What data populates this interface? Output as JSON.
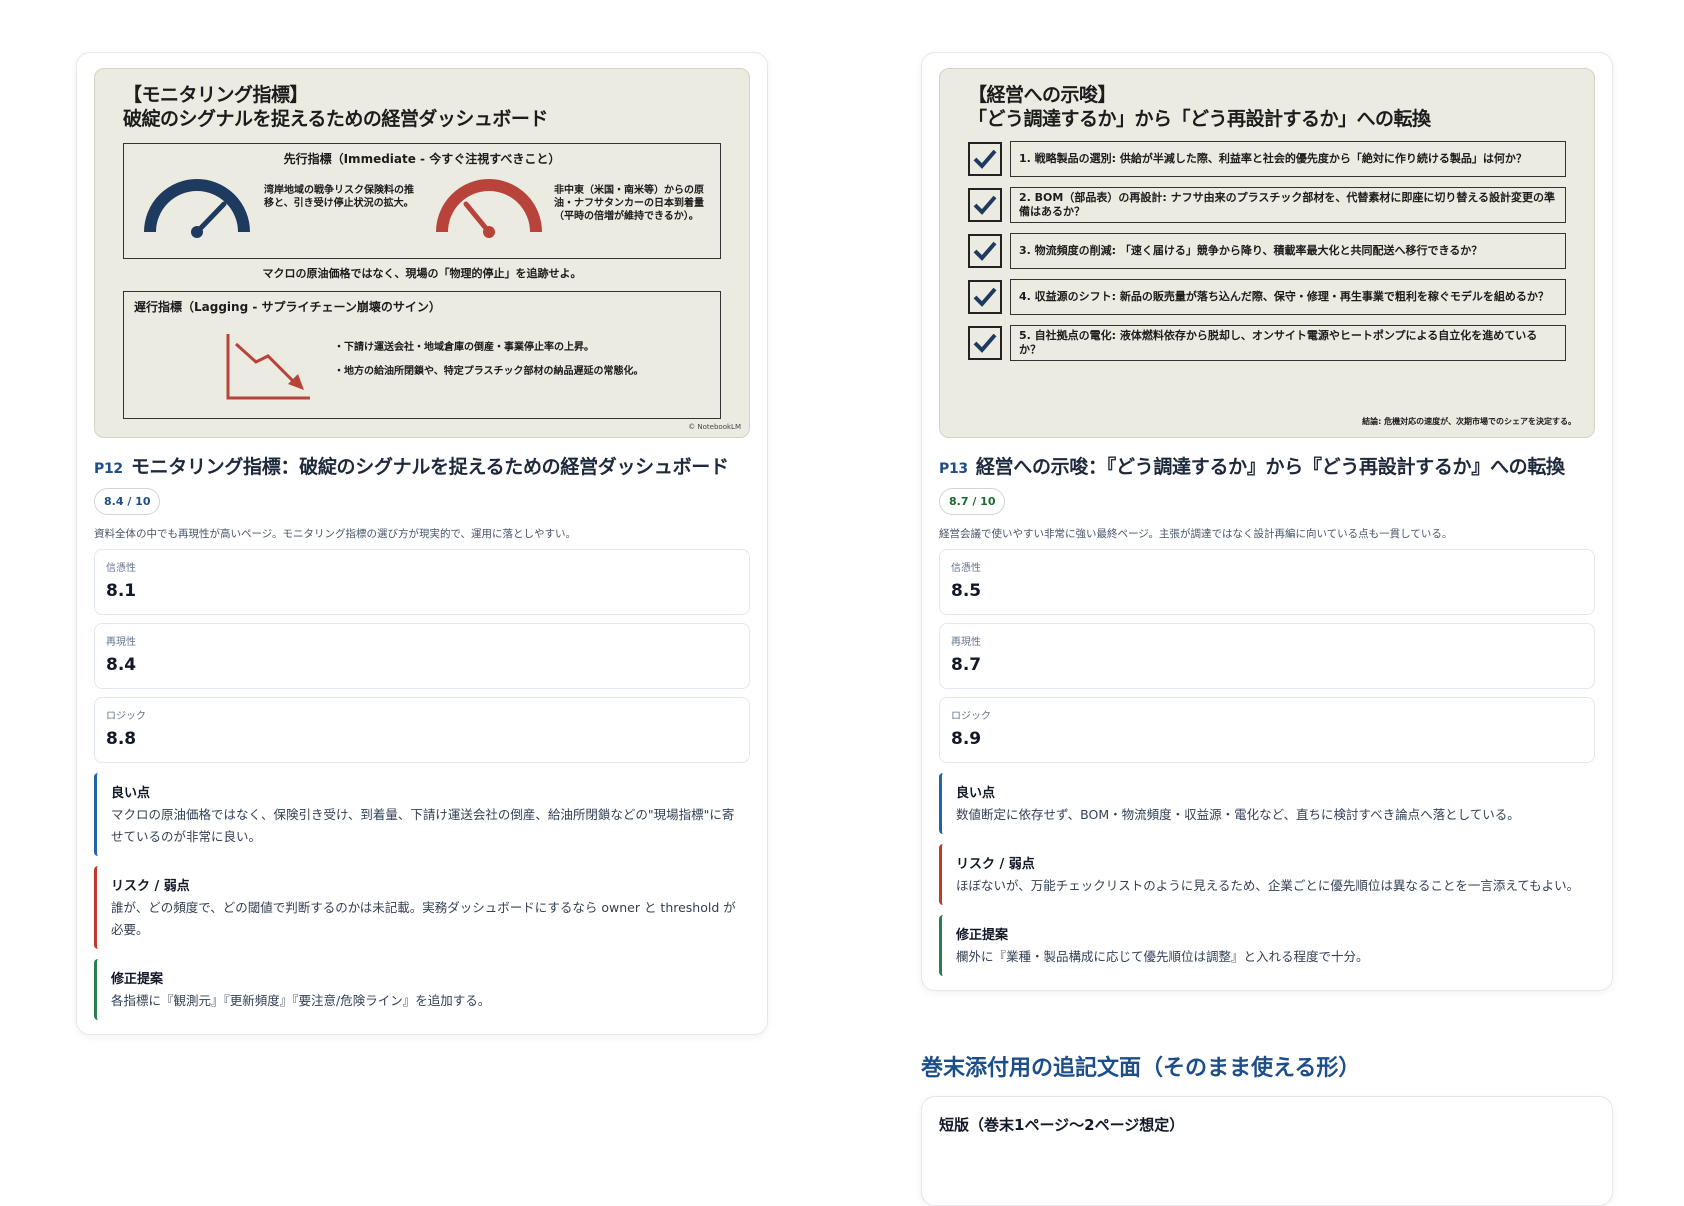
{
  "left": {
    "slide": {
      "title": "【モニタリング指標】\n破綻のシグナルを捉えるための経営ダッシュボード",
      "lead_head": "先行指標（Immediate - 今すぐ注視すべきこと）",
      "gauge1_text": "湾岸地域の戦争リスク保険料の推移と、引き受け停止状況の拡大。",
      "gauge2_text": "非中東（米国・南米等）からの原油・ナフサタンカーの日本到着量（平時の倍増が維持できるか）。",
      "note": "マクロの原油価格ではなく、現場の「物理的停止」を追跡せよ。",
      "lag_head": "遅行指標（Lagging - サプライチェーン崩壊のサイン）",
      "lag_bullet1": "・下請け運送会社・地域倉庫の倒産・事業停止率の上昇。",
      "lag_bullet2": "・地方の給油所閉鎖や、特定プラスチック部材の納品遅延の常態化。",
      "credit": "© NotebookLM"
    },
    "page_label": "P12",
    "page_title": "モニタリング指標：破綻のシグナルを捉えるための経営ダッシュボード",
    "score": "8.4 / 10",
    "summary": "資料全体の中でも再現性が高いページ。モニタリング指標の選び方が現実的で、運用に落としやすい。",
    "metrics": [
      {
        "label": "信憑性",
        "value": "8.1"
      },
      {
        "label": "再現性",
        "value": "8.4"
      },
      {
        "label": "ロジック",
        "value": "8.8"
      }
    ],
    "notes": {
      "good_title": "良い点",
      "good_body": "マクロの原油価格ではなく、保険引き受け、到着量、下請け運送会社の倒産、給油所閉鎖などの\"現場指標\"に寄せているのが非常に良い。",
      "risk_title": "リスク / 弱点",
      "risk_body": "誰が、どの頻度で、どの閾値で判断するのかは未記載。実務ダッシュボードにするなら owner と threshold が必要。",
      "fix_title": "修正提案",
      "fix_body": "各指標に『観測元』『更新頻度』『要注意/危険ライン』を追加する。"
    }
  },
  "right": {
    "slide": {
      "title": "【経営への示唆】\n「どう調達するか」から「どう再設計するか」への転換",
      "items": [
        "1. 戦略製品の選別: 供給が半減した際、利益率と社会的優先度から「絶対に作り続ける製品」は何か？",
        "2. BOM（部品表）の再設計: ナフサ由来のプラスチック部材を、代替素材に即座に切り替える設計変更の準備はあるか？",
        "3. 物流頻度の削減: 「速く届ける」競争から降り、積載率最大化と共同配送へ移行できるか？",
        "4. 収益源のシフト: 新品の販売量が落ち込んだ際、保守・修理・再生事業で粗利を稼ぐモデルを組めるか？",
        "5. 自社拠点の電化: 液体燃料依存から脱却し、オンサイト電源やヒートポンプによる自立化を進めているか？"
      ],
      "footer": "結論: 危機対応の速度が、次期市場でのシェアを決定する。"
    },
    "page_label": "P13",
    "page_title": "経営への示唆：『どう調達するか』から『どう再設計するか』への転換",
    "score": "8.7 / 10",
    "summary": "経営会議で使いやすい非常に強い最終ページ。主張が調達ではなく設計再編に向いている点も一貫している。",
    "metrics": [
      {
        "label": "信憑性",
        "value": "8.5"
      },
      {
        "label": "再現性",
        "value": "8.7"
      },
      {
        "label": "ロジック",
        "value": "8.9"
      }
    ],
    "notes": {
      "good_title": "良い点",
      "good_body": "数値断定に依存せず、BOM・物流頻度・収益源・電化など、直ちに検討すべき論点へ落としている。",
      "risk_title": "リスク / 弱点",
      "risk_body": "ほぼないが、万能チェックリストのように見えるため、企業ごとに優先順位は異なることを一言添えてもよい。",
      "fix_title": "修正提案",
      "fix_body": "欄外に『業種・製品構成に応じて優先順位は調整』と入れる程度で十分。"
    }
  },
  "appendix": {
    "heading": "巻末添付用の追記文面（そのまま使える形）",
    "subtitle": "短版（巻末1ページ〜2ページ想定）"
  },
  "colors": {
    "accent_blue": "#1d4e89",
    "good": "#2563a8",
    "risk": "#c0392b",
    "fix": "#2e7d4f"
  }
}
